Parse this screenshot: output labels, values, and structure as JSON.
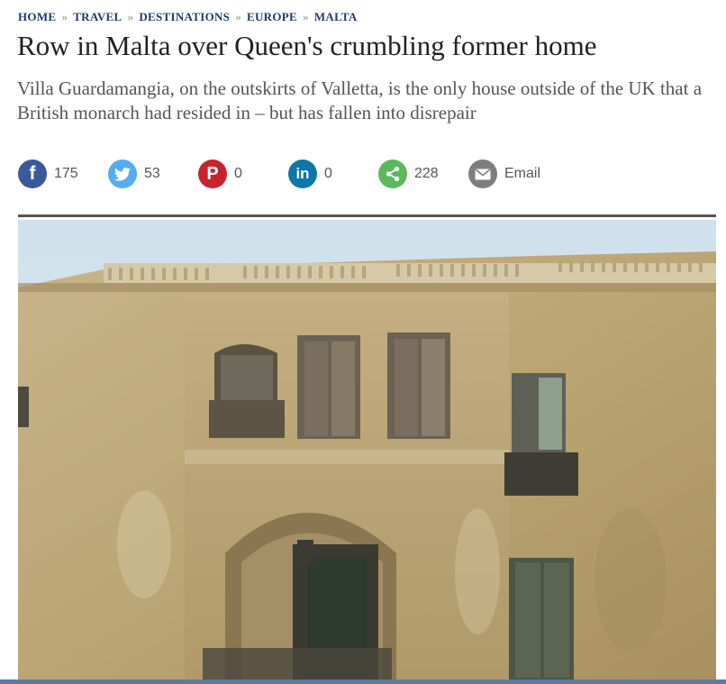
{
  "breadcrumb": {
    "items": [
      "HOME",
      "TRAVEL",
      "DESTINATIONS",
      "EUROPE",
      "MALTA"
    ],
    "separator": "»"
  },
  "article": {
    "headline": "Row in Malta over Queen's crumbling former home",
    "standfirst": "Villa Guardamangia, on the outskirts of Valletta, is the only house outside of the UK that a British monarch had resided in – but has fallen into disrepair"
  },
  "share": {
    "facebook": {
      "icon": "f",
      "count": "175"
    },
    "twitter": {
      "icon": "🐦",
      "count": "53"
    },
    "pinterest": {
      "icon": "P",
      "count": "0"
    },
    "linkedin": {
      "icon": "in",
      "count": "0"
    },
    "share": {
      "icon": "<",
      "count": "228"
    },
    "email": {
      "label": "Email"
    }
  },
  "colors": {
    "breadcrumb": "#1d3b6e",
    "facebook": "#3b5998",
    "twitter": "#55acee",
    "pinterest": "#c8232c",
    "linkedin": "#0e76a8",
    "share": "#5cb85c",
    "email": "#7d7d7d"
  }
}
